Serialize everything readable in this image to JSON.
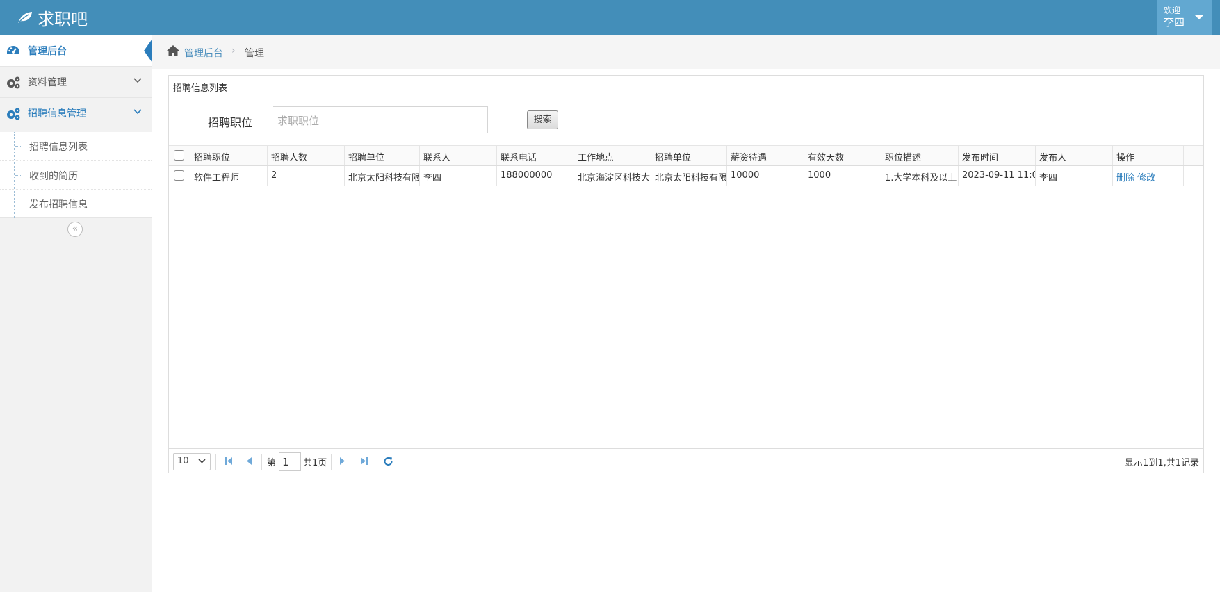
{
  "header": {
    "brand": "求职吧",
    "user_greeting": "欢迎",
    "user_name": "李四"
  },
  "sidebar": {
    "items": [
      {
        "label": "管理后台",
        "icon": "dashboard-icon",
        "active": true
      },
      {
        "label": "资料管理",
        "icon": "cogs-icon"
      },
      {
        "label": "招聘信息管理",
        "icon": "cogs-icon",
        "open": true
      }
    ],
    "subitems": [
      {
        "label": "招聘信息列表"
      },
      {
        "label": "收到的简历"
      },
      {
        "label": "发布招聘信息"
      }
    ],
    "collapse_glyph": "«"
  },
  "breadcrumb": {
    "home": "管理后台",
    "separator": "›",
    "current": "管理"
  },
  "panel": {
    "title": "招聘信息列表",
    "search_label": "招聘职位",
    "search_placeholder": "求职职位",
    "search_button": "搜索"
  },
  "table": {
    "columns": [
      "招聘职位",
      "招聘人数",
      "招聘单位",
      "联系人",
      "联系电话",
      "工作地点",
      "招聘单位",
      "薪资待遇",
      "有效天数",
      "职位描述",
      "发布时间",
      "发布人",
      "操作"
    ],
    "rows": [
      {
        "cells": [
          "软件工程师",
          "2",
          "北京太阳科技有限",
          "李四",
          "188000000",
          "北京海淀区科技大",
          "北京太阳科技有限",
          "10000",
          "1000",
          "1.大学本科及以上",
          "2023-09-11 11:0",
          "李四"
        ],
        "actions": [
          "删除",
          "修改"
        ]
      }
    ]
  },
  "pager": {
    "page_size": "10",
    "page_prefix": "第",
    "page_number": "1",
    "page_total": "共1页",
    "info": "显示1到1,共1记录"
  },
  "colors": {
    "navbar": "#438eb9",
    "accent": "#2b7dbc",
    "sidebar_bg": "#f2f2f2"
  }
}
